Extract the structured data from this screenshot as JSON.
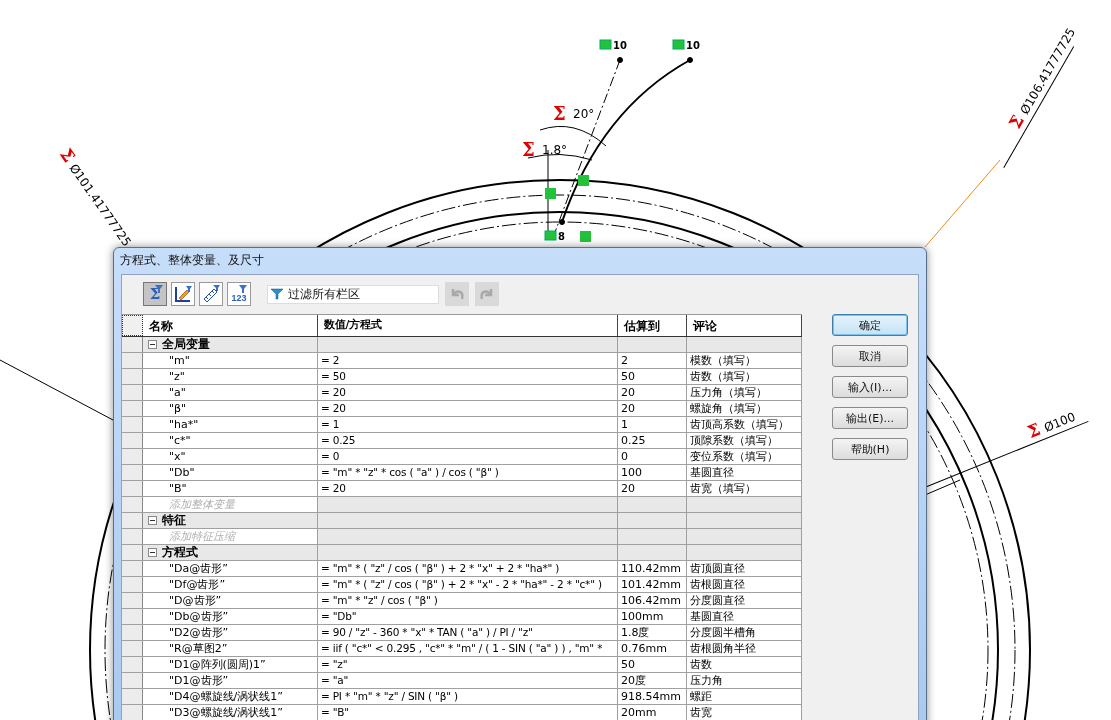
{
  "sketch": {
    "diameter_dimensions": [
      {
        "symbol": "Σ",
        "value": "Ø101.41777725"
      },
      {
        "symbol": "Σ",
        "value": "Ø106.41777725"
      },
      {
        "symbol": "Σ",
        "value": "Ø100"
      }
    ],
    "angle_dimensions": [
      {
        "symbol": "Σ",
        "value": "20°"
      },
      {
        "symbol": "Σ",
        "value": "1.8°"
      }
    ],
    "point_labels": [
      "10",
      "10",
      "8"
    ]
  },
  "dialog": {
    "title": "方程式、整体变量、及尺寸",
    "toolbar": {
      "view_buttons": [
        {
          "kind": "sigma",
          "label": "Σ",
          "selected": true
        },
        {
          "kind": "edit",
          "selected": false
        },
        {
          "kind": "dimension",
          "selected": false
        },
        {
          "kind": "numeric",
          "label": "123",
          "selected": false
        }
      ],
      "filter": {
        "placeholder": "过滤所有栏区"
      },
      "history_buttons": [
        {
          "kind": "undo",
          "disabled": true
        },
        {
          "kind": "redo",
          "disabled": true
        }
      ]
    },
    "table": {
      "columns": [
        "名称",
        "数值/方程式",
        "估算到",
        "评论"
      ],
      "groups": [
        {
          "title": "全局变量",
          "expanded": true,
          "rows": [
            {
              "name": "\"m\"",
              "value": "= 2",
              "evaluated": "2",
              "comment": "模数（填写）"
            },
            {
              "name": "\"z\"",
              "value": "= 50",
              "evaluated": "50",
              "comment": "齿数（填写）"
            },
            {
              "name": "\"a\"",
              "value": "= 20",
              "evaluated": "20",
              "comment": "压力角（填写）"
            },
            {
              "name": "\"β\"",
              "value": "= 20",
              "evaluated": "20",
              "comment": "螺旋角（填写）"
            },
            {
              "name": "\"ha*\"",
              "value": "= 1",
              "evaluated": "1",
              "comment": "齿顶高系数（填写）"
            },
            {
              "name": "\"c*\"",
              "value": "= 0.25",
              "evaluated": "0.25",
              "comment": "顶隙系数（填写）"
            },
            {
              "name": "\"x\"",
              "value": "= 0",
              "evaluated": "0",
              "comment": "变位系数（填写）"
            },
            {
              "name": "\"Db\"",
              "value": "= \"m\" * \"z\" * cos ( \"a\" ) /  cos ( \"β\" )",
              "evaluated": "100",
              "comment": "基圆直径"
            },
            {
              "name": "\"B\"",
              "value": "= 20",
              "evaluated": "20",
              "comment": "齿宽（填写）"
            }
          ],
          "add_hint": "添加整体变量"
        },
        {
          "title": "特征",
          "expanded": true,
          "add_hint": "添加特征压缩"
        },
        {
          "title": "方程式",
          "expanded": true,
          "rows": [
            {
              "name": "\"Da@齿形”",
              "value": "= \"m\" * ( \"z\" /  cos ( \"β\" ) + 2 * \"x\" + 2 * \"ha*\" )",
              "evaluated": "110.42mm",
              "comment": "齿顶圆直径"
            },
            {
              "name": "\"Df@齿形”",
              "value": "= \"m\" * ( \"z\" /  cos ( \"β\" ) + 2 * \"x\" - 2 * \"ha*\" - 2 * \"c*\" )",
              "evaluated": "101.42mm",
              "comment": "齿根圆直径"
            },
            {
              "name": "\"D@齿形”",
              "value": "= \"m\" * \"z\" /  cos ( \"β\" )",
              "evaluated": "106.42mm",
              "comment": "分度圆直径"
            },
            {
              "name": "\"Db@齿形”",
              "value": "= \"Db\"",
              "evaluated": "100mm",
              "comment": "基圆直径"
            },
            {
              "name": "\"D2@齿形”",
              "value": "= 90 / \"z\" - 360 * \"x\" * TAN ( \"a\" ) / PI / \"z\"",
              "evaluated": "1.8度",
              "comment": "分度圆半槽角"
            },
            {
              "name": "\"R@草图2”",
              "value": "= iif ( \"c*\" < 0.295 , \"c*\" * \"m\" / ( 1 - SIN ( \"a\" ) ) , \"m\" *",
              "evaluated": "0.76mm",
              "comment": "齿根圆角半径"
            },
            {
              "name": "\"D1@阵列(圆周)1”",
              "value": "= \"z\"",
              "evaluated": "50",
              "comment": "齿数"
            },
            {
              "name": "\"D1@齿形”",
              "value": "= \"a\"",
              "evaluated": "20度",
              "comment": "压力角"
            },
            {
              "name": "\"D4@螺旋线/涡状线1”",
              "value": "= PI * \"m\" * \"z\" / SIN ( \"β\" )",
              "evaluated": "918.54mm",
              "comment": "螺距"
            },
            {
              "name": "\"D3@螺旋线/涡状线1”",
              "value": "= \"B\"",
              "evaluated": "20mm",
              "comment": "齿宽"
            }
          ]
        }
      ]
    },
    "buttons": [
      {
        "label": "确定",
        "default": true
      },
      {
        "label": "取消",
        "default": false
      },
      {
        "label": "输入(I)...",
        "default": false
      },
      {
        "label": "输出(E)...",
        "default": false
      },
      {
        "label": "帮助(H)",
        "default": false
      }
    ]
  }
}
